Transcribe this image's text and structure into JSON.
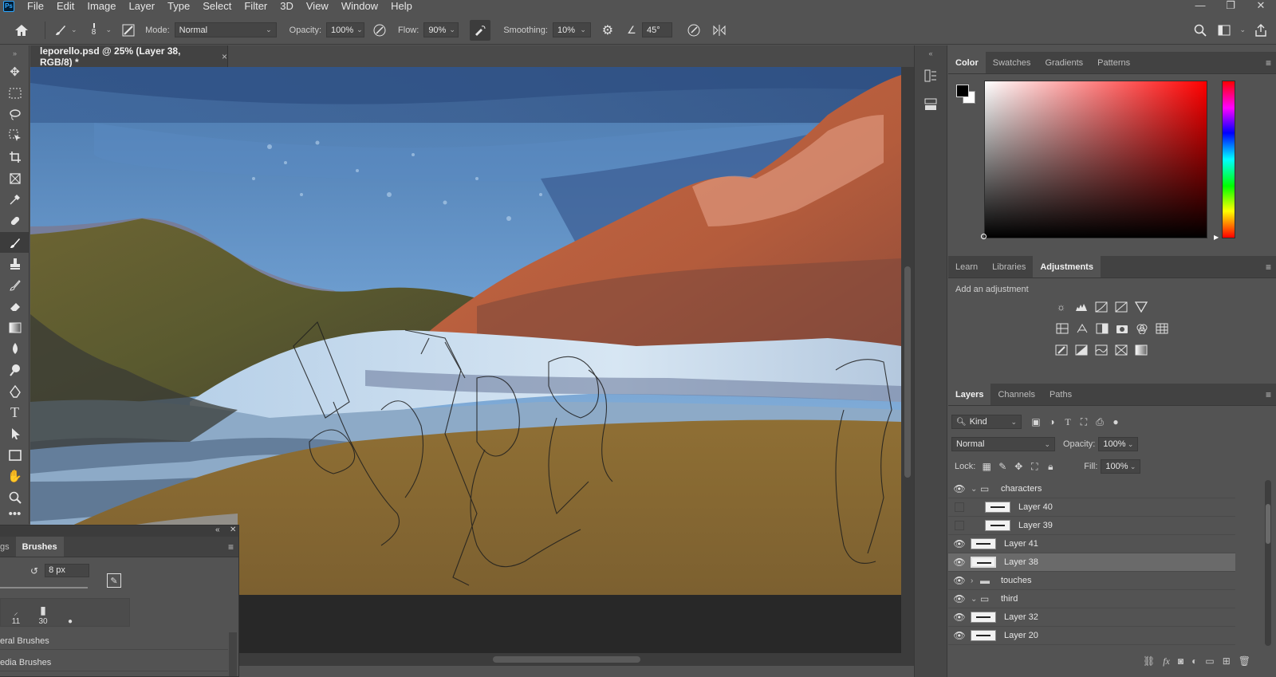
{
  "app": {
    "logo": "Ps",
    "menu": [
      "File",
      "Edit",
      "Image",
      "Layer",
      "Type",
      "Select",
      "Filter",
      "3D",
      "View",
      "Window",
      "Help"
    ],
    "window_controls": [
      "—",
      "❐",
      "✕"
    ]
  },
  "options_bar": {
    "brush_size": "8",
    "mode_label": "Mode:",
    "mode_value": "Normal",
    "opacity_label": "Opacity:",
    "opacity_value": "100%",
    "flow_label": "Flow:",
    "flow_value": "90%",
    "smoothing_label": "Smoothing:",
    "smoothing_value": "10%",
    "angle_value": "45°"
  },
  "document": {
    "tab_title": "leporello.psd @ 25% (Layer 38, RGB/8) *",
    "close": "×"
  },
  "color_panel": {
    "tabs": [
      "Color",
      "Swatches",
      "Gradients",
      "Patterns"
    ],
    "active_tab": "Color",
    "foreground": "#000000",
    "background": "#ffffff",
    "hue": "#ff0000"
  },
  "adjustments_panel": {
    "tabs": [
      "Learn",
      "Libraries",
      "Adjustments"
    ],
    "active_tab": "Adjustments",
    "hint": "Add an adjustment"
  },
  "layers_panel": {
    "tabs": [
      "Layers",
      "Channels",
      "Paths"
    ],
    "active_tab": "Layers",
    "filter_value": "Kind",
    "blend_mode": "Normal",
    "opacity_label": "Opacity:",
    "opacity_value": "100%",
    "lock_label": "Lock:",
    "fill_label": "Fill:",
    "fill_value": "100%",
    "layers": [
      {
        "name": "characters",
        "type": "group",
        "visible": true,
        "expanded": true
      },
      {
        "name": "Layer 40",
        "type": "layer",
        "visible": false
      },
      {
        "name": "Layer 39",
        "type": "layer",
        "visible": false
      },
      {
        "name": "Layer 41",
        "type": "layer",
        "visible": true
      },
      {
        "name": "Layer 38",
        "type": "layer",
        "visible": true,
        "selected": true
      },
      {
        "name": "touches",
        "type": "group",
        "visible": true,
        "expanded": false
      },
      {
        "name": "third",
        "type": "group",
        "visible": true,
        "expanded": true
      },
      {
        "name": "Layer 32",
        "type": "layer",
        "visible": true
      },
      {
        "name": "Layer 20",
        "type": "layer",
        "visible": true
      }
    ]
  },
  "brushes_panel": {
    "tabs": [
      "gs",
      "Brushes"
    ],
    "active_tab": "Brushes",
    "size_value": "8 px",
    "presets": [
      "11",
      "30",
      ""
    ],
    "groups": [
      "eral Brushes",
      "edia Brushes"
    ]
  }
}
